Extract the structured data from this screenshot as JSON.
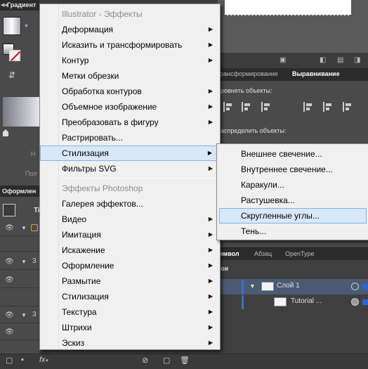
{
  "left_panel": {
    "gradient_title": "Градиент",
    "layers_title": "Оформлен",
    "label_ti": "Ti",
    "label_n": "Н",
    "label_pol": "Пол"
  },
  "effects_menu": {
    "illustrator_header": "Illustrator - Эффекты",
    "illustrator_items": [
      {
        "label": "Деформация",
        "submenu": true
      },
      {
        "label": "Исказить и трансформировать",
        "submenu": true
      },
      {
        "label": "Контур",
        "submenu": true
      },
      {
        "label": "Метки обрезки",
        "submenu": false
      },
      {
        "label": "Обработка контуров",
        "submenu": true
      },
      {
        "label": "Объемное изображение",
        "submenu": true
      },
      {
        "label": "Преобразовать в фигуру",
        "submenu": true
      },
      {
        "label": "Растрировать...",
        "submenu": false
      },
      {
        "label": "Стилизация",
        "submenu": true
      },
      {
        "label": "Фильтры SVG",
        "submenu": true
      }
    ],
    "photoshop_header": "Эффекты Photoshop",
    "photoshop_items": [
      {
        "label": "Галерея эффектов...",
        "submenu": false
      },
      {
        "label": "Видео",
        "submenu": true
      },
      {
        "label": "Имитация",
        "submenu": true
      },
      {
        "label": "Искажение",
        "submenu": true
      },
      {
        "label": "Оформление",
        "submenu": true
      },
      {
        "label": "Размытие",
        "submenu": true
      },
      {
        "label": "Стилизация",
        "submenu": true
      },
      {
        "label": "Текстура",
        "submenu": true
      },
      {
        "label": "Штрихи",
        "submenu": true
      },
      {
        "label": "Эскиз",
        "submenu": true
      }
    ],
    "highlighted": "Стилизация",
    "arrow_glyph": "▶"
  },
  "stylize_submenu": {
    "items": [
      "Внешнее свечение...",
      "Внутреннее свечение...",
      "Каракули...",
      "Растушевка...",
      "Скругленные углы...",
      "Тень..."
    ],
    "highlighted": "Скругленные углы..."
  },
  "right_panels": {
    "tabs": [
      "рансформирование",
      "Выравнивание"
    ],
    "align_objects_label": "ровнять объекты:",
    "distribute_objects_label": "аспределить объекты:",
    "layers_tabs": [
      "имвол",
      "Абзац",
      "OpenType"
    ],
    "layers_header": "юи",
    "layer_name": "Слой 1",
    "sublayer_name": "Tutorial  ..."
  },
  "colors": {
    "menu_bg": "#f0f0f0",
    "highlight_bg": "#d9e8f8",
    "highlight_border": "#7eb4ea",
    "panel_dark": "#2b2b2b",
    "layer_selected": "#4a5b73",
    "layer_accent": "#3b6fd0"
  },
  "bottom_bar": {
    "fx_label": "fx"
  }
}
